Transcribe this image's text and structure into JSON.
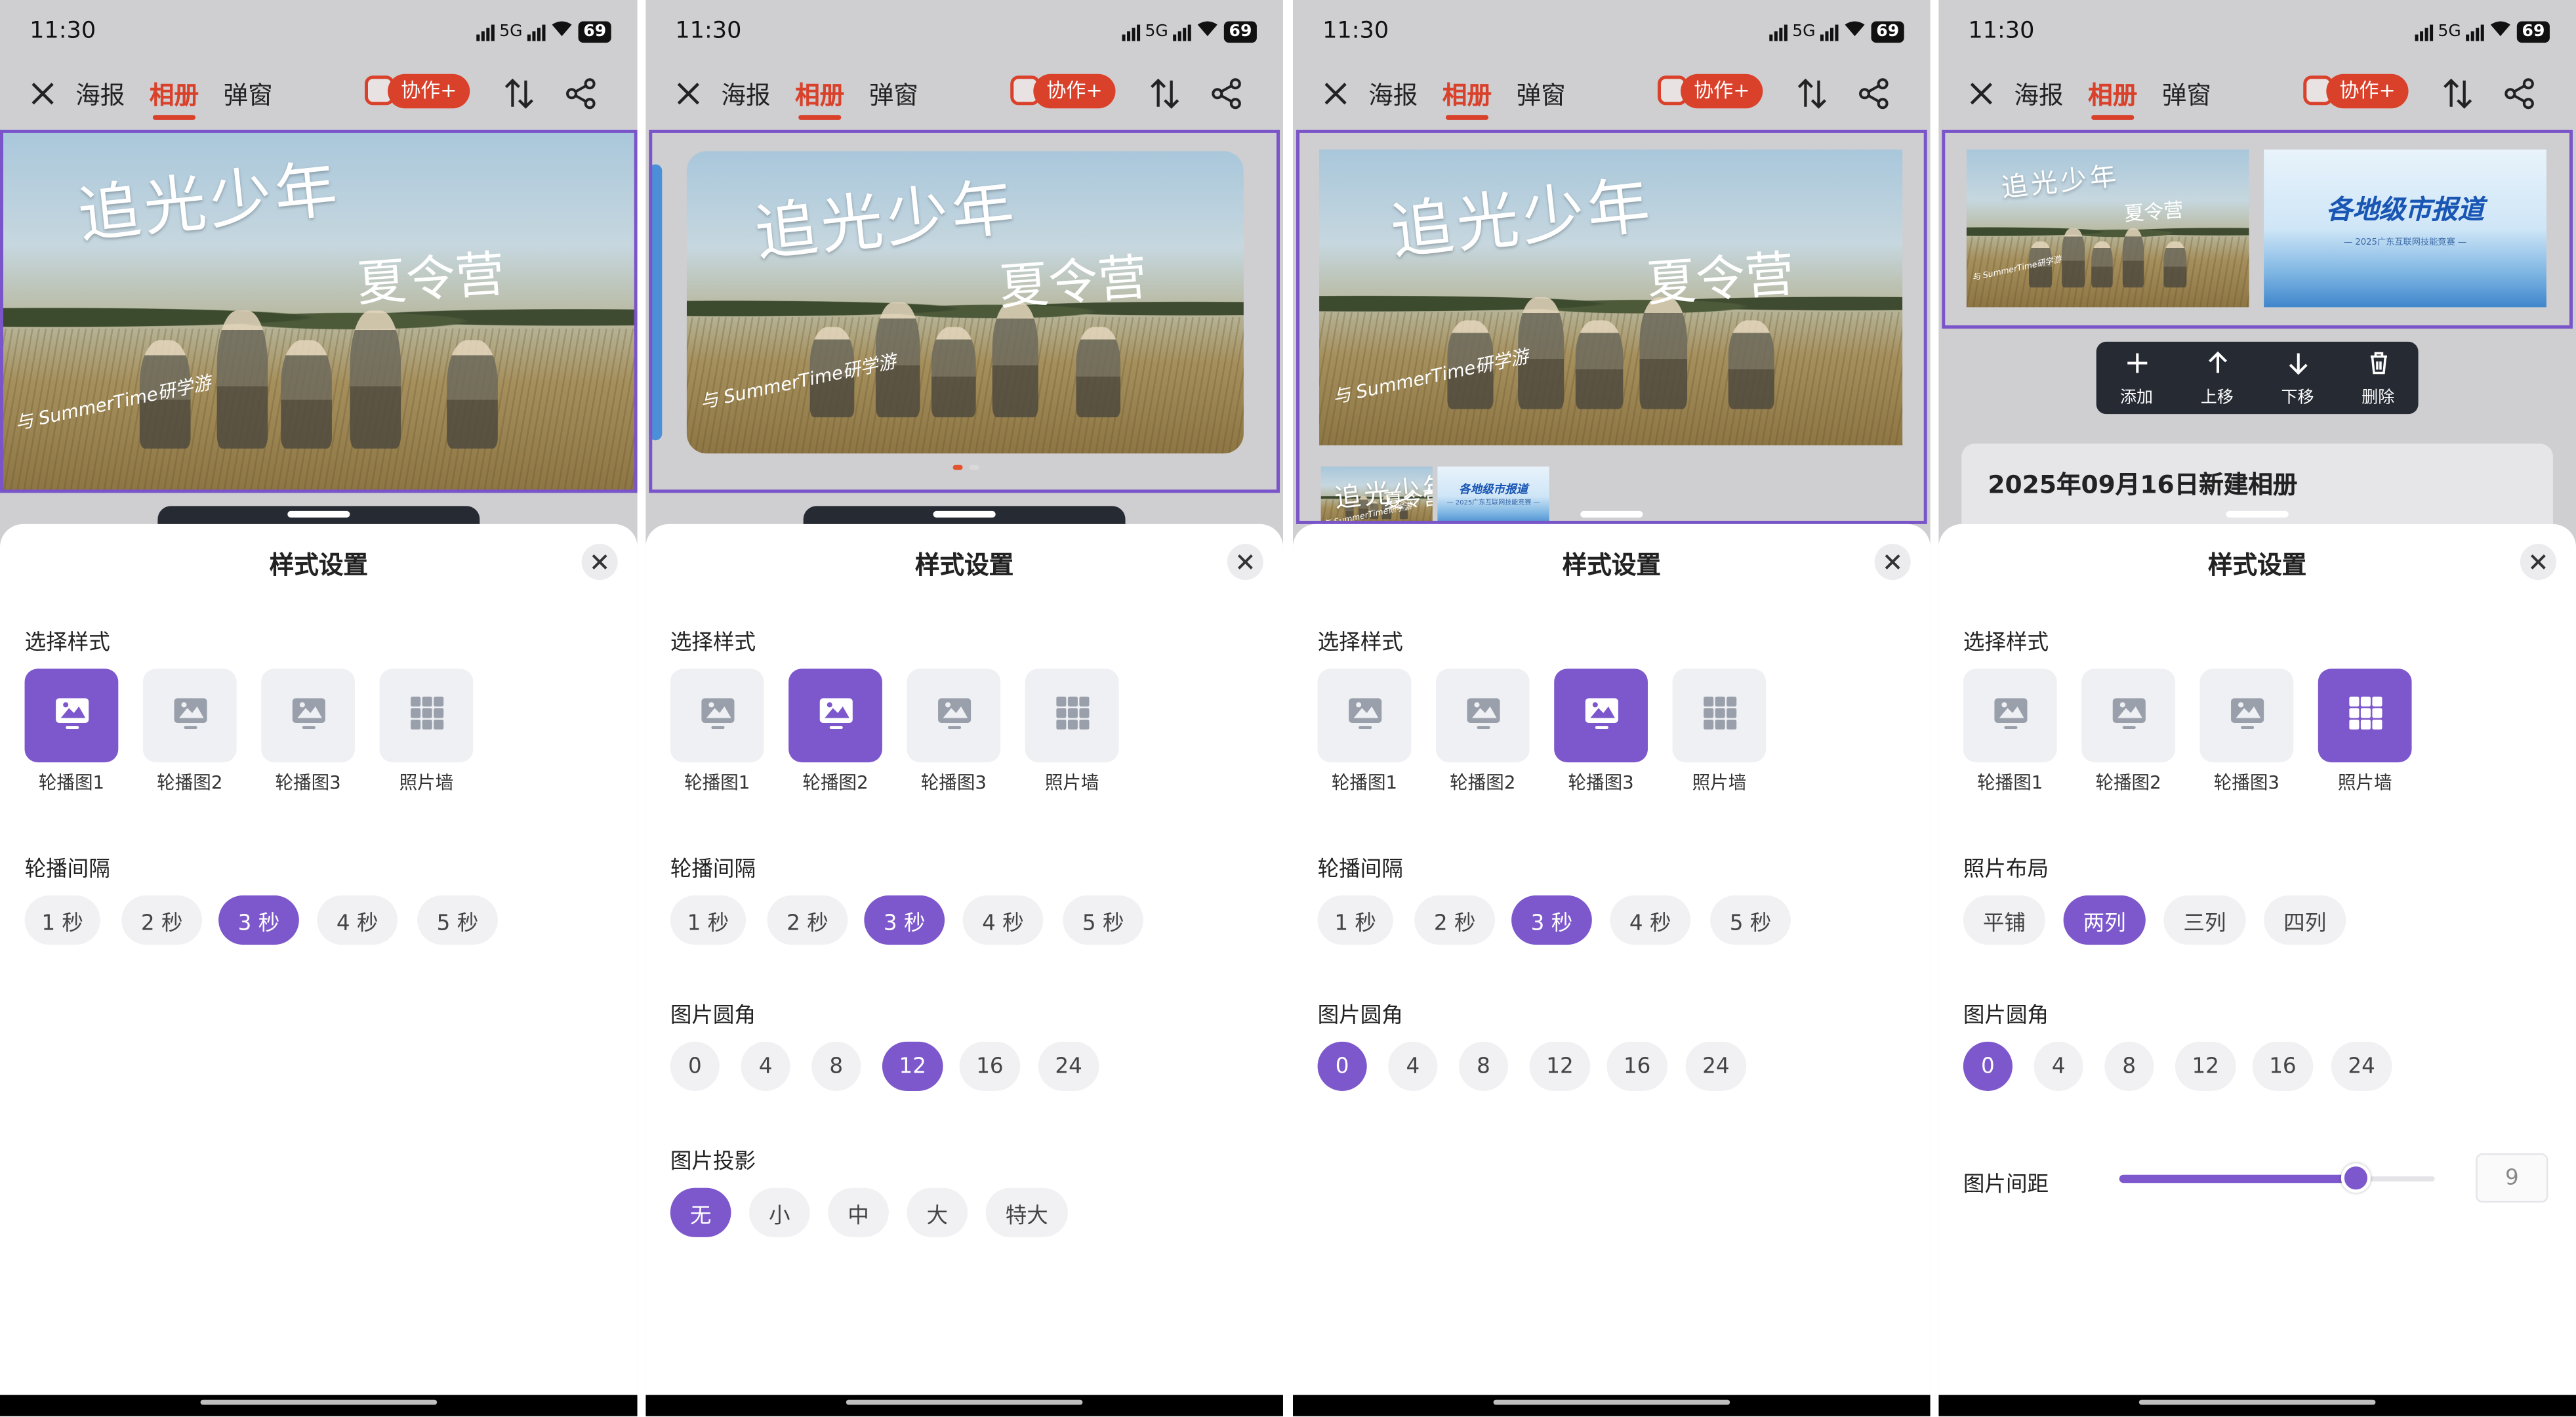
{
  "status": {
    "time": "11:30",
    "network": "5G",
    "battery": "69"
  },
  "nav": {
    "tabs": [
      "海报",
      "相册",
      "弹窗"
    ],
    "active_tab": "相册",
    "collab_label": "协作+"
  },
  "sheet": {
    "title": "样式设置"
  },
  "labels": {
    "select_style": "选择样式",
    "interval": "轮播间隔",
    "radius": "图片圆角",
    "shadow": "图片投影",
    "layout": "照片布局",
    "spacing": "图片间距"
  },
  "styles": [
    "轮播图1",
    "轮播图2",
    "轮播图3",
    "照片墙"
  ],
  "options": {
    "interval": [
      "1 秒",
      "2 秒",
      "3 秒",
      "4 秒",
      "5 秒"
    ],
    "radius": [
      "0",
      "4",
      "8",
      "12",
      "16",
      "24"
    ],
    "shadow": [
      "无",
      "小",
      "中",
      "大",
      "特大"
    ],
    "layout": [
      "平铺",
      "两列",
      "三列",
      "四列"
    ]
  },
  "banner": {
    "title": "追光少年",
    "subtitle": "夏令营",
    "tagline": "与 SummerTime研学游",
    "alt_title": "各地级市报道",
    "alt_subtitle": "— 2025广东互联网技能竞赛 —"
  },
  "actions": [
    {
      "icon": "plus-icon",
      "label": "添加"
    },
    {
      "icon": "arrow-up-icon",
      "label": "上移"
    },
    {
      "icon": "arrow-down-icon",
      "label": "下移"
    },
    {
      "icon": "trash-icon",
      "label": "删除"
    }
  ],
  "album": {
    "title": "2025年09月16日新建相册"
  },
  "screens": [
    {
      "selected_style": 0,
      "interval_selected": 2
    },
    {
      "selected_style": 1,
      "interval_selected": 2,
      "radius_selected": 3,
      "shadow_selected": 0
    },
    {
      "selected_style": 2,
      "interval_selected": 2,
      "radius_selected": 0
    },
    {
      "selected_style": 3,
      "layout_selected": 1,
      "radius_selected": 0,
      "spacing_value": "9",
      "spacing_fraction": 0.75
    }
  ],
  "colors": {
    "accent": "#7d57cc",
    "brand_red": "#d9412b",
    "frame": "#7a55c9"
  }
}
